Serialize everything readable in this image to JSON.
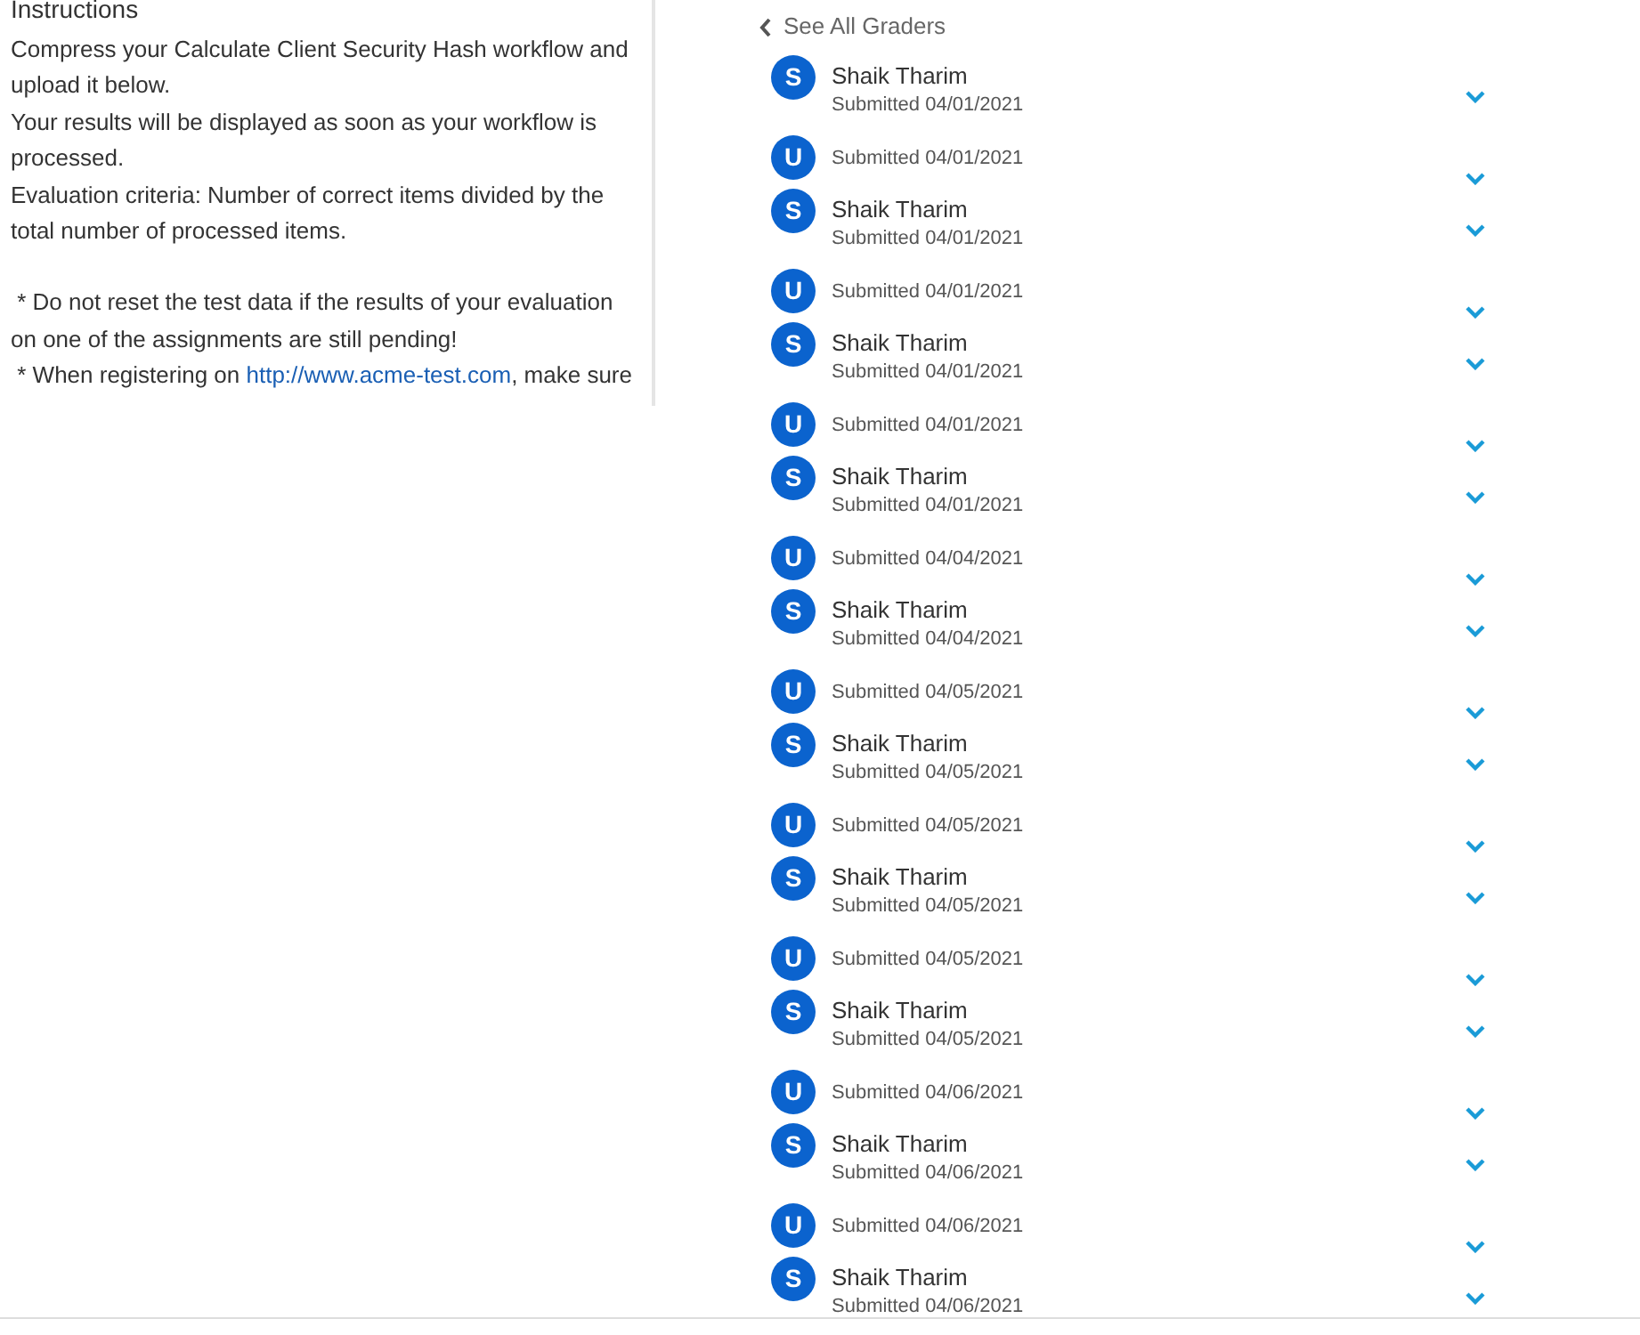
{
  "instructions": {
    "title": "Instructions",
    "paragraphs": [
      "Compress your Calculate Client Security Hash workflow and upload it below.",
      "Your results will be displayed as soon as your workflow is processed.",
      "Evaluation criteria: Number of correct items divided by the total number of processed items."
    ],
    "notes": [
      {
        "text": " * Do not reset the test data if the results of your evaluation on one of the assignments are still pending!"
      },
      {
        "text": " * When registering on ",
        "link": "http://www.acme-test.com",
        "after": ", make sure"
      }
    ]
  },
  "back_link": "See All Graders",
  "submissions": [
    {
      "initial": "S",
      "name": "Shaik Tharim",
      "date": "Submitted 04/01/2021"
    },
    {
      "initial": "U",
      "date": "Submitted 04/01/2021"
    },
    {
      "initial": "S",
      "name": "Shaik Tharim",
      "date": "Submitted 04/01/2021"
    },
    {
      "initial": "U",
      "date": "Submitted 04/01/2021"
    },
    {
      "initial": "S",
      "name": "Shaik Tharim",
      "date": "Submitted 04/01/2021"
    },
    {
      "initial": "U",
      "date": "Submitted 04/01/2021"
    },
    {
      "initial": "S",
      "name": "Shaik Tharim",
      "date": "Submitted 04/01/2021"
    },
    {
      "initial": "U",
      "date": "Submitted 04/04/2021"
    },
    {
      "initial": "S",
      "name": "Shaik Tharim",
      "date": "Submitted 04/04/2021"
    },
    {
      "initial": "U",
      "date": "Submitted 04/05/2021"
    },
    {
      "initial": "S",
      "name": "Shaik Tharim",
      "date": "Submitted 04/05/2021"
    },
    {
      "initial": "U",
      "date": "Submitted 04/05/2021"
    },
    {
      "initial": "S",
      "name": "Shaik Tharim",
      "date": "Submitted 04/05/2021"
    },
    {
      "initial": "U",
      "date": "Submitted 04/05/2021"
    },
    {
      "initial": "S",
      "name": "Shaik Tharim",
      "date": "Submitted 04/05/2021"
    },
    {
      "initial": "U",
      "date": "Submitted 04/06/2021"
    },
    {
      "initial": "S",
      "name": "Shaik Tharim",
      "date": "Submitted 04/06/2021"
    },
    {
      "initial": "U",
      "date": "Submitted 04/06/2021"
    },
    {
      "initial": "S",
      "name": "Shaik Tharim",
      "date": "Submitted 04/06/2021"
    }
  ]
}
